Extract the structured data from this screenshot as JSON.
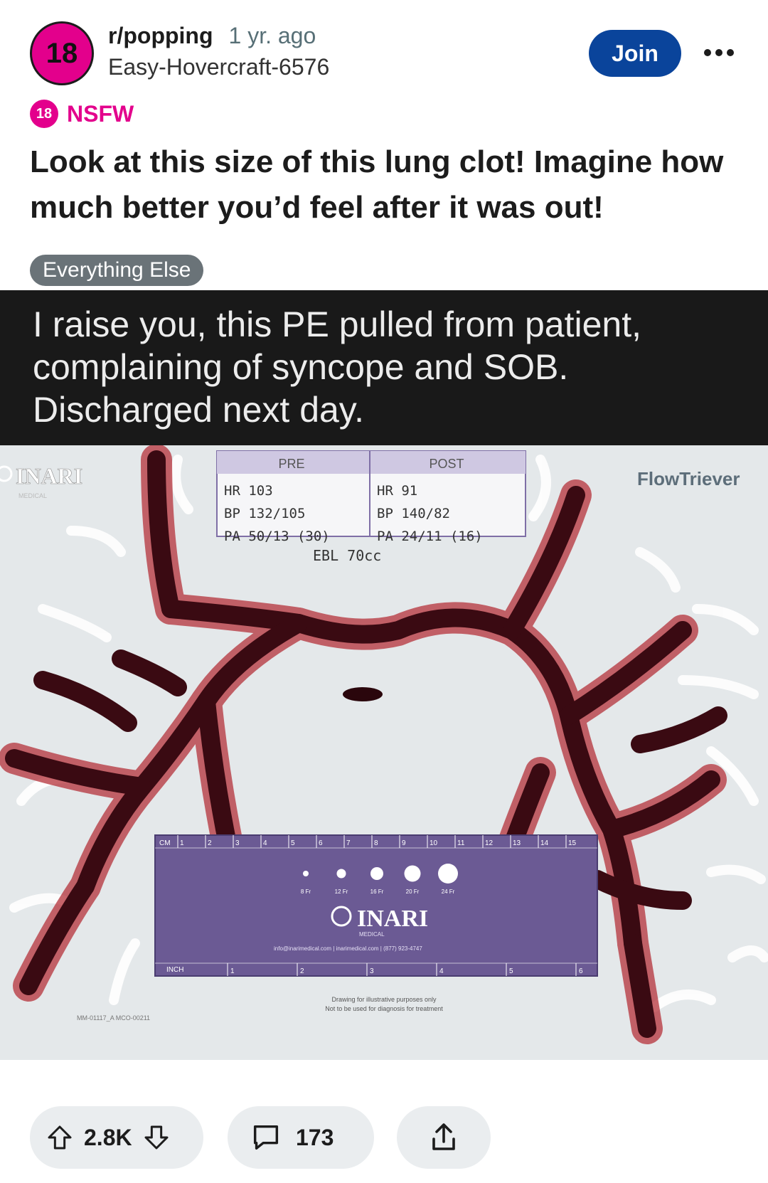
{
  "header": {
    "avatar_text": "18",
    "subreddit": "r/popping",
    "age": "1 yr. ago",
    "author": "Easy-Hovercraft-6576",
    "join_label": "Join"
  },
  "nsfw": {
    "badge": "18",
    "label": "NSFW"
  },
  "post": {
    "title": "Look at this size of this lung clot! Imagine how much better you’d feel after it was out!",
    "flair": "Everything Else"
  },
  "media": {
    "caption": "I raise you, this PE pulled from patient, complaining of syncope and SOB. Discharged next day.",
    "card": {
      "brand_left": "INARI",
      "brand_left_sub": "MEDICAL",
      "brand_right": "FlowTriever",
      "pre_header": "PRE",
      "post_header": "POST",
      "pre_lines": [
        "HR 103",
        "BP 132/105",
        "PA 50/13 (30)"
      ],
      "post_lines": [
        "HR 91",
        "BP 140/82",
        "PA 24/11 (16)"
      ],
      "ebl": "EBL 70cc",
      "ruler_cm": "CM",
      "ruler_inch": "INCH",
      "cm_ticks": [
        "1",
        "2",
        "3",
        "4",
        "5",
        "6",
        "7",
        "8",
        "9",
        "10",
        "11",
        "12",
        "13",
        "14",
        "15"
      ],
      "inch_ticks": [
        "1",
        "2",
        "3",
        "4",
        "5",
        "6"
      ],
      "catheter_sizes": [
        "8 Fr",
        "12 Fr",
        "16 Fr",
        "20 Fr",
        "24 Fr"
      ],
      "ruler_brand": "INARI",
      "ruler_brand_sub": "MEDICAL",
      "contact": "info@inarimedical.com | inarimedical.com | (877) 923-4747",
      "disclaimer_1": "Drawing for illustrative purposes only",
      "disclaimer_2": "Not to be used for diagnosis for treatment",
      "part_no": "MM-01117_A MCO-00211"
    }
  },
  "actions": {
    "votes": "2.8K",
    "comments": "173"
  },
  "colors": {
    "nsfw_pink": "#e3008c",
    "join_blue": "#0a449b",
    "clot": "#3a0a12",
    "ruler_purple": "#6b5a94"
  }
}
